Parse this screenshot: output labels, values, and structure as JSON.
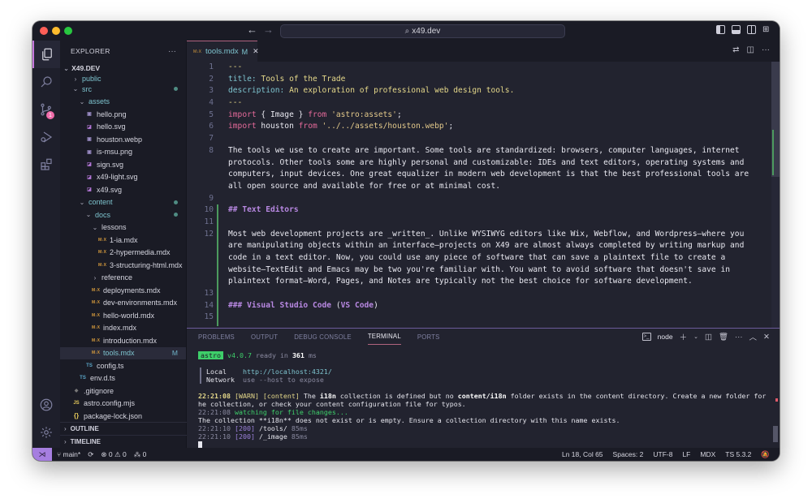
{
  "titlebar": {
    "search_text": "x49.dev",
    "back_icon": "arrow-left-icon",
    "forward_icon": "arrow-right-icon",
    "layout_icons": [
      "toggle-primary-sidebar-icon",
      "toggle-panel-icon",
      "toggle-secondary-sidebar-icon",
      "customize-layout-icon"
    ]
  },
  "activity_bar": {
    "items": [
      {
        "name": "explorer",
        "icon": "files-icon",
        "active": true
      },
      {
        "name": "search",
        "icon": "search-icon"
      },
      {
        "name": "source-control",
        "icon": "source-control-icon",
        "badge": "1"
      },
      {
        "name": "run-debug",
        "icon": "run-debug-icon"
      },
      {
        "name": "extensions",
        "icon": "extensions-icon"
      }
    ],
    "bottom": [
      {
        "name": "accounts",
        "icon": "account-icon"
      },
      {
        "name": "manage",
        "icon": "gear-icon"
      }
    ]
  },
  "sidebar": {
    "title": "EXPLORER",
    "more": "···",
    "root": "X49.DEV",
    "tree": [
      {
        "label": "public",
        "type": "folder",
        "depth": 1,
        "expanded": false
      },
      {
        "label": "src",
        "type": "folder",
        "depth": 1,
        "expanded": true,
        "dot": true
      },
      {
        "label": "assets",
        "type": "folder",
        "depth": 2,
        "expanded": true
      },
      {
        "label": "hello.png",
        "type": "img",
        "depth": 3
      },
      {
        "label": "hello.svg",
        "type": "svg",
        "depth": 3
      },
      {
        "label": "houston.webp",
        "type": "img",
        "depth": 3
      },
      {
        "label": "is-msu.png",
        "type": "img",
        "depth": 3
      },
      {
        "label": "sign.svg",
        "type": "svg",
        "depth": 3
      },
      {
        "label": "x49-light.svg",
        "type": "svg",
        "depth": 3
      },
      {
        "label": "x49.svg",
        "type": "svg",
        "depth": 3
      },
      {
        "label": "content",
        "type": "folder",
        "depth": 2,
        "expanded": true,
        "dot": true
      },
      {
        "label": "docs",
        "type": "folder",
        "depth": 3,
        "expanded": true,
        "dot": true
      },
      {
        "label": "lessons",
        "type": "folder-plain",
        "depth": 4,
        "expanded": true
      },
      {
        "label": "1-ia.mdx",
        "type": "mdx",
        "depth": 5
      },
      {
        "label": "2-hypermedia.mdx",
        "type": "mdx",
        "depth": 5
      },
      {
        "label": "3-structuring-html.mdx",
        "type": "mdx",
        "depth": 5
      },
      {
        "label": "reference",
        "type": "folder-plain",
        "depth": 4,
        "expanded": false
      },
      {
        "label": "deployments.mdx",
        "type": "mdx",
        "depth": 4
      },
      {
        "label": "dev-environments.mdx",
        "type": "mdx",
        "depth": 4
      },
      {
        "label": "hello-world.mdx",
        "type": "mdx",
        "depth": 4
      },
      {
        "label": "index.mdx",
        "type": "mdx",
        "depth": 4
      },
      {
        "label": "introduction.mdx",
        "type": "mdx",
        "depth": 4
      },
      {
        "label": "tools.mdx",
        "type": "mdx",
        "depth": 4,
        "selected": true,
        "status": "M"
      },
      {
        "label": "config.ts",
        "type": "ts",
        "depth": 3
      },
      {
        "label": "env.d.ts",
        "type": "ts",
        "depth": 2
      },
      {
        "label": ".gitignore",
        "type": "git",
        "depth": 1
      },
      {
        "label": "astro.config.mjs",
        "type": "js",
        "depth": 1
      },
      {
        "label": "package-lock.json",
        "type": "json",
        "depth": 1
      }
    ],
    "sections": [
      "OUTLINE",
      "TIMELINE"
    ]
  },
  "editor": {
    "tab": {
      "label": "tools.mdx",
      "status": "M",
      "icon": "M↓X"
    },
    "actions": [
      "compare-changes-icon",
      "split-editor-icon",
      "more-actions-icon"
    ],
    "lines": [
      {
        "n": "1",
        "segs": [
          [
            "k-yellow",
            "---"
          ]
        ]
      },
      {
        "n": "2",
        "segs": [
          [
            "k-cyan",
            "title"
          ],
          [
            "k-cyan",
            ": "
          ],
          [
            "k-yellow",
            "Tools of the Trade"
          ]
        ]
      },
      {
        "n": "3",
        "segs": [
          [
            "k-cyan",
            "description"
          ],
          [
            "k-cyan",
            ": "
          ],
          [
            "k-yellow",
            "An exploration of professional web design tools."
          ]
        ]
      },
      {
        "n": "4",
        "segs": [
          [
            "k-yellow",
            "---"
          ]
        ]
      },
      {
        "n": "5",
        "segs": [
          [
            "k-pink",
            "import"
          ],
          [
            "k-white",
            " { Image } "
          ],
          [
            "k-pink",
            "from"
          ],
          [
            "k-white",
            " "
          ],
          [
            "k-str",
            "'astro:assets'"
          ],
          [
            "k-white",
            ";"
          ]
        ]
      },
      {
        "n": "6",
        "segs": [
          [
            "k-pink",
            "import"
          ],
          [
            "k-white",
            " houston "
          ],
          [
            "k-pink",
            "from"
          ],
          [
            "k-white",
            " "
          ],
          [
            "k-str",
            "'../../assets/houston.webp'"
          ],
          [
            "k-white",
            ";"
          ]
        ]
      },
      {
        "n": "7",
        "segs": []
      },
      {
        "n": "8",
        "segs": [
          [
            "k-white",
            "The tools we use to create are important. Some tools are standardized: browsers, computer languages, internet"
          ]
        ]
      },
      {
        "n": "",
        "segs": [
          [
            "k-white",
            "protocols. Other tools some are highly personal and customizable: IDEs and text editors, operating systems and"
          ]
        ]
      },
      {
        "n": "",
        "segs": [
          [
            "k-white",
            "computers, input devices. One great equalizer in modern web development is that the best professional tools are"
          ]
        ]
      },
      {
        "n": "",
        "segs": [
          [
            "k-white",
            "all open source and available for free or at minimal cost."
          ]
        ]
      },
      {
        "n": "9",
        "segs": []
      },
      {
        "n": "10",
        "segs": [
          [
            "k-head",
            "## Text Editors"
          ]
        ]
      },
      {
        "n": "11",
        "segs": []
      },
      {
        "n": "12",
        "segs": [
          [
            "k-white",
            "Most web development projects are _written_. Unlike WYSIWYG editors like Wix, Webflow, and Wordpress—where you"
          ]
        ]
      },
      {
        "n": "",
        "segs": [
          [
            "k-white",
            "are manipulating objects within an interface—projects on X49 are almost always completed by writing markup and"
          ]
        ]
      },
      {
        "n": "",
        "segs": [
          [
            "k-white",
            "code in a text editor. Now, you could use any piece of software that can save a plaintext file to create a"
          ]
        ]
      },
      {
        "n": "",
        "segs": [
          [
            "k-white",
            "website—TextEdit and Emacs may be two you're familiar with. You want to avoid software that doesn't save in"
          ]
        ]
      },
      {
        "n": "",
        "segs": [
          [
            "k-white",
            "plaintext format—Word, Pages, and Notes are typically not the best choice for software development."
          ]
        ]
      },
      {
        "n": "13",
        "segs": []
      },
      {
        "n": "14",
        "segs": [
          [
            "k-head",
            "### Visual Studio Code "
          ],
          [
            "k-white",
            "("
          ],
          [
            "k-head",
            "VS Code"
          ],
          [
            "k-white",
            ")"
          ]
        ]
      },
      {
        "n": "15",
        "segs": []
      }
    ]
  },
  "panel": {
    "tabs": [
      {
        "label": "PROBLEMS"
      },
      {
        "label": "OUTPUT"
      },
      {
        "label": "DEBUG CONSOLE"
      },
      {
        "label": "TERMINAL",
        "active": true
      },
      {
        "label": "PORTS"
      }
    ],
    "terminal_name": "node",
    "actions": [
      "new-terminal-icon",
      "terminal-dropdown-icon",
      "split-terminal-icon",
      "kill-terminal-icon",
      "more-icon",
      "maximize-panel-icon",
      "close-panel-icon"
    ],
    "terminal": {
      "astro_badge": "astro",
      "version": "v4.0.7",
      "ready_text": "ready in",
      "ready_ms": "361",
      "ms": "ms",
      "local_label": "Local",
      "local_url": "http://localhost:4321/",
      "network_label": "Network",
      "network_text": "use --host to expose",
      "log": [
        {
          "time": "22:21:08",
          "parts": [
            [
              "t-warn",
              " [WARN]"
            ],
            [
              "t-warn",
              " [content]"
            ],
            [
              "",
              " The "
            ],
            [
              "t-bold",
              "i18n"
            ],
            [
              "",
              " collection is defined but no "
            ],
            [
              "t-bold",
              "content/i18n"
            ],
            [
              "",
              " folder exists in the content directory. Create a new folder for t"
            ]
          ],
          "time_class": "t-yellow"
        },
        {
          "time": "",
          "parts": [
            [
              "",
              "he collection, or check your content configuration file for typos."
            ]
          ]
        },
        {
          "time": "22:21:08",
          "parts": [
            [
              "t-green",
              " watching for file changes..."
            ]
          ],
          "time_class": "t-gray"
        },
        {
          "time": "",
          "parts": [
            [
              "",
              "The collection **i18n** does not exist or is empty. Ensure a collection directory with this name exists."
            ]
          ]
        },
        {
          "time": "22:21:10",
          "parts": [
            [
              "t-purple",
              " [200]"
            ],
            [
              "",
              " /tools/"
            ],
            [
              "t-gray",
              " 85ms"
            ]
          ],
          "time_class": "t-gray"
        },
        {
          "time": "22:21:10",
          "parts": [
            [
              "t-purple",
              " [200]"
            ],
            [
              "",
              " /_image"
            ],
            [
              "t-gray",
              " 85ms"
            ]
          ],
          "time_class": "t-gray"
        }
      ]
    }
  },
  "statusbar": {
    "remote_icon": "remote-icon",
    "branch": "main*",
    "sync_icon": "sync-icon",
    "errors": "0",
    "warnings": "0",
    "ports": "0",
    "position": "Ln 18, Col 65",
    "spaces": "Spaces: 2",
    "encoding": "UTF-8",
    "eol": "LF",
    "language": "MDX",
    "ts_version": "TS 5.3.2",
    "notifications_icon": "bell-slash-icon"
  },
  "colors": {
    "accent": "#c678dd",
    "tab_border": "#b0637e",
    "remote_bg": "#a67ee0",
    "astro_badge": "#3ecf6a",
    "badge": "#f06caa"
  }
}
